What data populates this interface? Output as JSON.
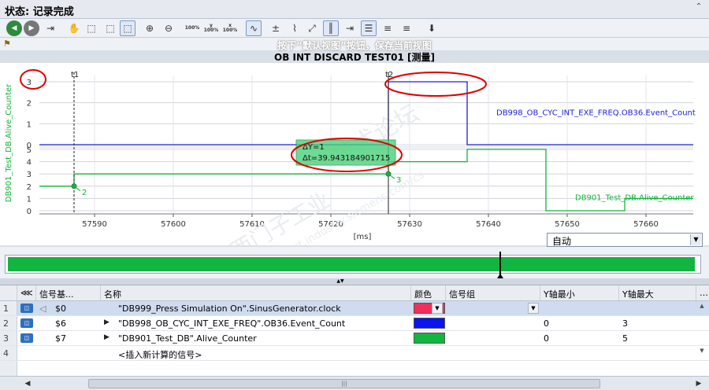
{
  "status": {
    "title": "状态: 记录完成"
  },
  "toolbar": {
    "buttons": [
      {
        "name": "back-icon",
        "glyph": "◀"
      },
      {
        "name": "forward-icon",
        "glyph": "▶"
      },
      {
        "name": "export-icon",
        "glyph": "⇥"
      },
      {
        "name": "pan-hand-icon",
        "glyph": "✋"
      },
      {
        "name": "zoom-select-icon",
        "glyph": "⬚"
      },
      {
        "name": "zoom-fit-icon",
        "glyph": "⬚"
      },
      {
        "name": "zoom-box-icon",
        "glyph": "⬚"
      },
      {
        "name": "zoom-in-icon",
        "glyph": "⊕"
      },
      {
        "name": "zoom-out-icon",
        "glyph": "⊖"
      },
      {
        "name": "zoom-100-icon",
        "glyph": "100%"
      },
      {
        "name": "y-axis-100-icon",
        "glyph": "Y"
      },
      {
        "name": "x-axis-100-icon",
        "glyph": "X"
      },
      {
        "name": "waveform-icon",
        "glyph": "∿"
      },
      {
        "name": "time-marker-icon",
        "glyph": "±"
      },
      {
        "name": "curve-icon",
        "glyph": "⌇"
      },
      {
        "name": "expand-icon",
        "glyph": "⤢"
      },
      {
        "name": "measure-cursor-icon",
        "glyph": "║"
      },
      {
        "name": "insert-cursor-icon",
        "glyph": "⇥"
      },
      {
        "name": "list-view-icon",
        "glyph": "☰"
      },
      {
        "name": "align-left-icon",
        "glyph": "≡"
      },
      {
        "name": "align-right-icon",
        "glyph": "≡"
      },
      {
        "name": "pin-icon",
        "glyph": "⬇"
      }
    ],
    "zoom100": "100%",
    "y100": "y 100%",
    "x100": "x 100%"
  },
  "hint": {
    "text": "按下“默认视图”按钮，保存当前视图"
  },
  "chart_data": {
    "type": "line",
    "title": "OB INT DISCARD TEST01 [测量]",
    "xlabel": "[ms]",
    "xlim": [
      57583,
      57666
    ],
    "xticks": [
      57590,
      57600,
      57610,
      57620,
      57630,
      57640,
      57650,
      57660
    ],
    "ylabel": "DB901_Test_DB.Alive_Counter",
    "cursors": [
      {
        "label": "t1",
        "x": 57587.4
      },
      {
        "label": "t2",
        "x": 57627.3
      }
    ],
    "measurement": {
      "dy": "ΔY=1",
      "dt": "Δt=39.943184901715"
    },
    "cursor_values": [
      {
        "label": "2",
        "series": "DB901_Test_DB.Alive_Counter"
      },
      {
        "label": "3",
        "series": "DB901_Test_DB.Alive_Counter"
      }
    ],
    "series": [
      {
        "name": "DB998_OB_CYC_INT_EXE_FREQ.OB36.Event_Count",
        "color": "#2020d8",
        "ylim": [
          0,
          3
        ],
        "yticks": [
          0,
          1,
          2,
          3
        ],
        "x": [
          57583,
          57627.3,
          57627.3,
          57637.3,
          57637.3,
          57666
        ],
        "y": [
          0,
          0,
          3,
          3,
          0,
          0
        ]
      },
      {
        "name": "DB901_Test_DB.Alive_Counter",
        "color": "#13b33a",
        "ylim": [
          0,
          5
        ],
        "yticks": [
          0,
          1,
          2,
          3,
          4,
          5
        ],
        "x": [
          57583,
          57587.4,
          57587.4,
          57627.3,
          57627.3,
          57637.3,
          57637.3,
          57647.3,
          57647.3,
          57657.3,
          57657.3,
          57666
        ],
        "y": [
          2,
          2,
          3,
          3,
          4,
          4,
          5,
          5,
          0,
          0,
          1,
          1
        ]
      }
    ],
    "annotations": [
      "support.industry.siemens.com/cs",
      "西门子工业",
      "技术论坛"
    ]
  },
  "unit_select": {
    "value": "自动"
  },
  "table": {
    "headers": {
      "num": "",
      "signal_addr": "信号基...",
      "name": "名称",
      "color": "颜色",
      "group": "信号组",
      "ymin": "Y轴最小",
      "ymax": "Y轴最大"
    },
    "rows": [
      {
        "num": "1",
        "addr": "$0",
        "name": "\"DB999_Press Simulation On\".SinusGenerator.clock",
        "color": "#f0305a",
        "group": "",
        "ymin": "",
        "ymax": "",
        "selected": true
      },
      {
        "num": "2",
        "addr": "$6",
        "name": "\"DB998_OB_CYC_INT_EXE_FREQ\".OB36.Event_Count",
        "color": "#0a14f0",
        "group": "",
        "ymin": "0",
        "ymax": "3",
        "selected": false
      },
      {
        "num": "3",
        "addr": "$7",
        "name": "\"DB901_Test_DB\".Alive_Counter",
        "color": "#12b53f",
        "group": "",
        "ymin": "0",
        "ymax": "5",
        "selected": false
      },
      {
        "num": "4",
        "addr": "",
        "name": "<插入新计算的信号>",
        "color": "",
        "group": "",
        "ymin": "",
        "ymax": "",
        "selected": false
      }
    ]
  }
}
